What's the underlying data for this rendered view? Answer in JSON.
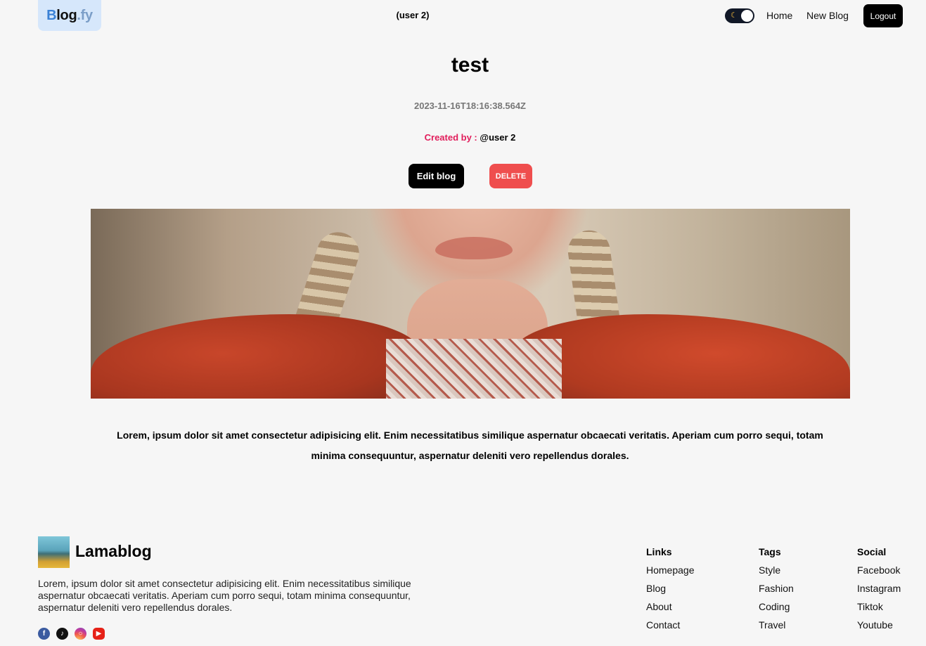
{
  "header": {
    "logo": {
      "part1": "B",
      "part2": "log",
      "part3": ".fy"
    },
    "user_label": "(user 2)",
    "nav": {
      "home": "Home",
      "new_blog": "New Blog",
      "logout": "Logout"
    }
  },
  "post": {
    "title": "test",
    "date": "2023-11-16T18:16:38.564Z",
    "created_by_label": "Created by :",
    "author": "@user 2",
    "edit_label": "Edit blog",
    "delete_label": "DELETE",
    "body": "Lorem, ipsum dolor sit amet consectetur adipisicing elit. Enim necessitatibus similique aspernatur obcaecati veritatis. Aperiam cum porro sequi, totam minima consequuntur, aspernatur deleniti vero repellendus dorales."
  },
  "footer": {
    "brand": "Lamablog",
    "description": "Lorem, ipsum dolor sit amet consectetur adipisicing elit. Enim necessitatibus similique aspernatur obcaecati veritatis. Aperiam cum porro sequi, totam minima consequuntur, aspernatur deleniti vero repellendus dorales.",
    "social_icons": [
      "facebook-icon",
      "tiktok-icon",
      "instagram-icon",
      "youtube-icon"
    ],
    "columns": {
      "links": {
        "title": "Links",
        "items": [
          "Homepage",
          "Blog",
          "About",
          "Contact"
        ]
      },
      "tags": {
        "title": "Tags",
        "items": [
          "Style",
          "Fashion",
          "Coding",
          "Travel"
        ]
      },
      "social": {
        "title": "Social",
        "items": [
          "Facebook",
          "Instagram",
          "Tiktok",
          "Youtube"
        ]
      }
    }
  }
}
